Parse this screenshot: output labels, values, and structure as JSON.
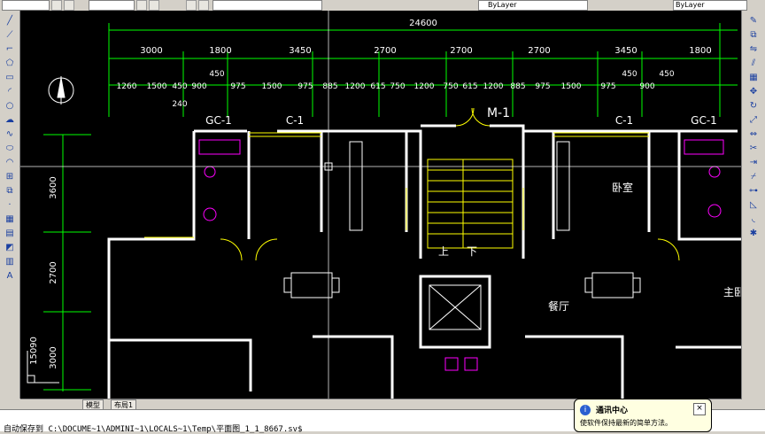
{
  "toolbar": {
    "layer_combo": "　ByLayer",
    "linetype_combo": "ByLayer",
    "left_combo": "",
    "mid_combo": ""
  },
  "tabs": {
    "model": "模型",
    "layout1": "布局1"
  },
  "command_line": {
    "prefix": "自动保存到",
    "path": "C:\\DOCUME~1\\ADMINI~1\\LOCALS~1\\Temp\\平面图_1_1_8667.sv$"
  },
  "balloon": {
    "title": "通讯中心",
    "body": "使软件保持最新的简单方法。",
    "close": "×"
  },
  "drawing": {
    "dim_total": "24600",
    "dims_row2": [
      "3000",
      "1800",
      "3450",
      "2700",
      "2700",
      "2700",
      "3450",
      "1800"
    ],
    "dims_row3": [
      "1260",
      "1500",
      "450",
      "900",
      "450",
      "975",
      "1500",
      "975",
      "885",
      "1200",
      "615",
      "750",
      "1200",
      "750",
      "615",
      "1200",
      "885",
      "975",
      "1500",
      "975",
      "450",
      "900",
      "450"
    ],
    "dim_240": "240",
    "left_dims": [
      "3600",
      "2700",
      "3000"
    ],
    "left_total": "15090",
    "labels": {
      "gc1_left": "GC-1",
      "c1_left": "C-1",
      "m1": "M-1",
      "c1_right": "C-1",
      "gc1_right": "GC-1",
      "bedroom": "卧室",
      "up": "上",
      "down": "下",
      "dining": "餐厅",
      "master": "主卧"
    },
    "colors": {
      "dim": "#00ff00",
      "wall": "#ffffff",
      "window": "#ffff00",
      "fixture": "#ff00ff",
      "crosshair": "#ffffff"
    }
  }
}
